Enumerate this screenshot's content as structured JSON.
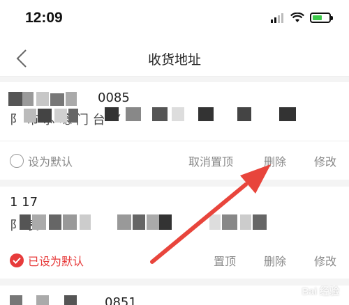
{
  "status_bar": {
    "time": "12:09"
  },
  "nav": {
    "title": "收货地址"
  },
  "addresses": [
    {
      "name_phone": "0085",
      "address": "阝 市 ⺗ 埝 ⻔ 台 ⺌ 罒",
      "default_label": "设为默认",
      "is_default": false,
      "actions": [
        "取消置顶",
        "删除",
        "修改"
      ]
    },
    {
      "name_phone": "1 17",
      "address": "阝 表",
      "default_label": "已设为默认",
      "is_default": true,
      "actions": [
        "置顶",
        "删除",
        "修改"
      ]
    },
    {
      "name_phone": "0851"
    }
  ],
  "colors": {
    "accent": "#e73b3b",
    "arrow": "#e8453c"
  },
  "watermark": "Bai 经验"
}
